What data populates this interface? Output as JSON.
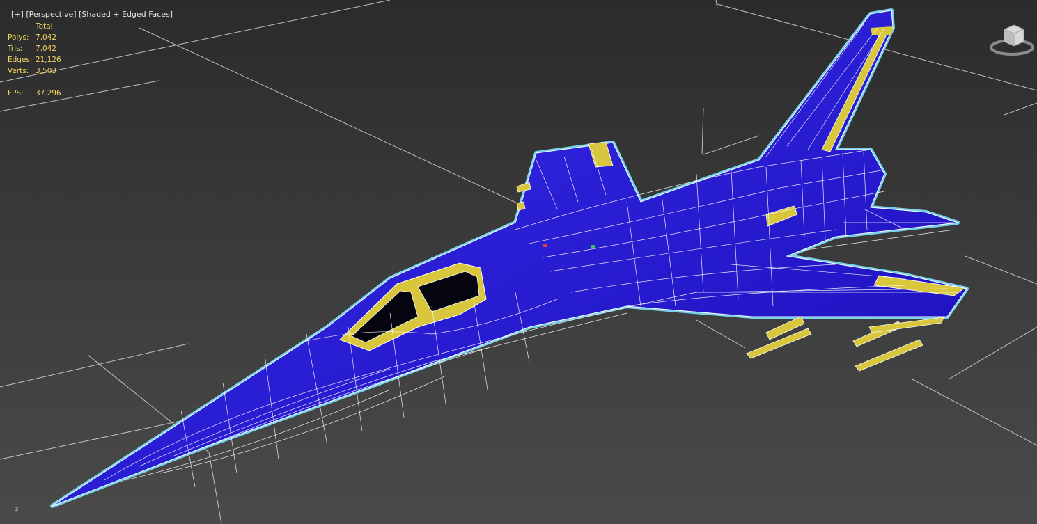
{
  "viewport": {
    "label_plus": "[+]",
    "label_view": "[Perspective]",
    "label_shading": "[Shaded + Edged Faces]"
  },
  "stats": {
    "header": "Total",
    "rows": [
      {
        "key": "Polys:",
        "value": "7,042"
      },
      {
        "key": "Tris:",
        "value": "7,042"
      },
      {
        "key": "Edges:",
        "value": "21,126"
      },
      {
        "key": "Verts:",
        "value": "3,503"
      }
    ],
    "fps_key": "FPS:",
    "fps_value": "37.296"
  },
  "gizmo": {
    "z_label": "z"
  },
  "colors": {
    "model_fill": "#1f12c8",
    "edge_color": "#ffffff",
    "selection_outline": "#7fe3ff",
    "accent_yellow": "#d8c73c",
    "stats_text": "#f2d55c",
    "grid": "#d9d9d9"
  },
  "icons": {
    "viewcube": "viewcube-icon"
  }
}
